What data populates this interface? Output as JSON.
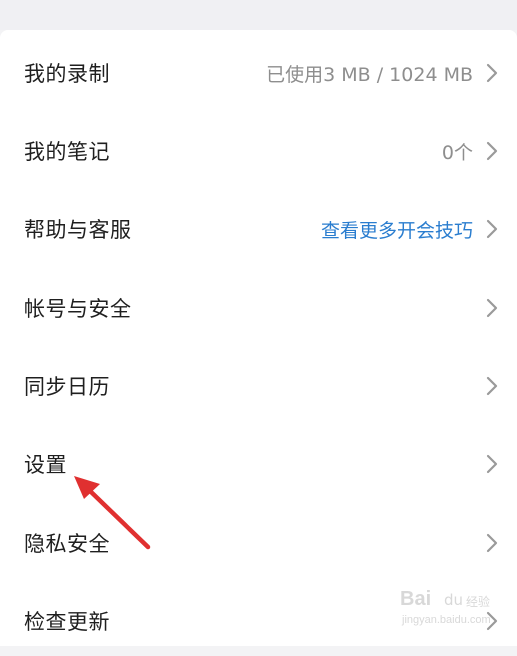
{
  "menu": {
    "items": [
      {
        "label": "我的录制",
        "value": "已使用3 MB / 1024 MB",
        "value_style": "muted"
      },
      {
        "label": "我的笔记",
        "value": "0个",
        "value_style": "muted"
      },
      {
        "label": "帮助与客服",
        "value": "查看更多开会技巧",
        "value_style": "link"
      },
      {
        "label": "帐号与安全",
        "value": ""
      },
      {
        "label": "同步日历",
        "value": ""
      },
      {
        "label": "设置",
        "value": ""
      },
      {
        "label": "隐私安全",
        "value": ""
      },
      {
        "label": "检查更新",
        "value": ""
      }
    ],
    "chevron_icon": "chevron-right-icon"
  },
  "annotation": {
    "icon": "red-arrow-icon",
    "color": "#e03030",
    "points_to": "设置"
  },
  "watermark": {
    "brand": "Bai",
    "paw": "du",
    "sub": "经验",
    "url": "jingyan.baidu.com"
  },
  "colors": {
    "label": "#1f1f1f",
    "muted": "#8e8e8e",
    "link": "#2a7dcf",
    "chevron": "#9a9a9a",
    "background": "#ffffff"
  }
}
